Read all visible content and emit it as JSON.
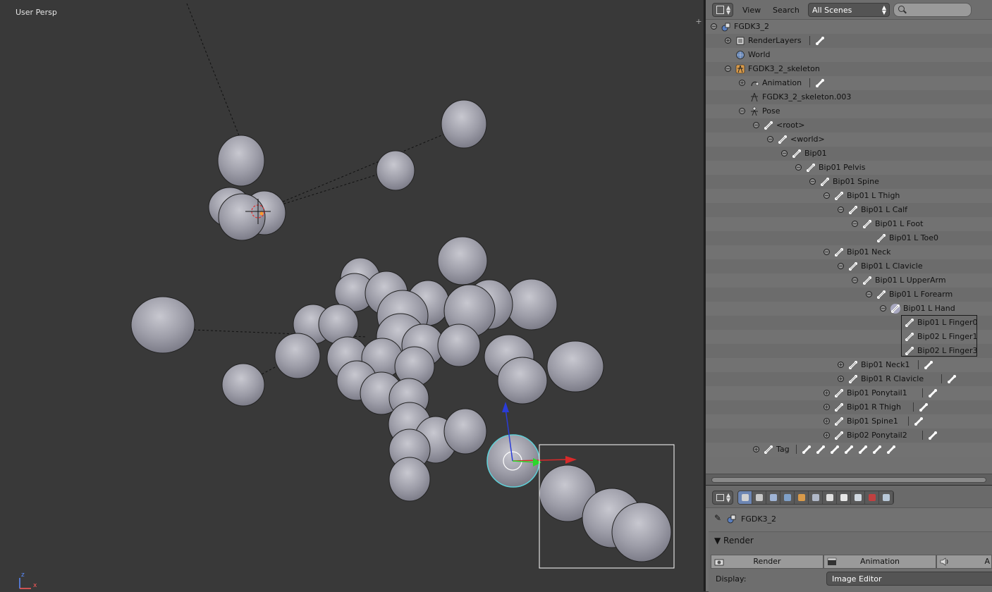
{
  "viewport": {
    "label": "User Persp",
    "axis_z": "z",
    "axis_x": "x",
    "plus_icon": "plus-icon"
  },
  "outliner": {
    "menu_view": "View",
    "menu_search": "Search",
    "scene_select": "All Scenes",
    "search_placeholder": "",
    "tree": [
      {
        "label": "FGDK3_2",
        "indent": 0,
        "exp": "minus",
        "icon": "scene-icon"
      },
      {
        "label": "RenderLayers",
        "indent": 1,
        "exp": "plus",
        "icon": "renderlayers-icon",
        "extra": 1
      },
      {
        "label": "World",
        "indent": 1,
        "exp": "none",
        "icon": "world-icon"
      },
      {
        "label": "FGDK3_2_skeleton",
        "indent": 1,
        "exp": "minus",
        "icon": "armature-object-icon"
      },
      {
        "label": "Animation",
        "indent": 2,
        "exp": "plus",
        "icon": "animation-icon",
        "extra": 1
      },
      {
        "label": "FGDK3_2_skeleton.003",
        "indent": 2,
        "exp": "none",
        "icon": "armature-data-icon"
      },
      {
        "label": "Pose",
        "indent": 2,
        "exp": "minus",
        "icon": "pose-icon"
      },
      {
        "label": "<root>",
        "indent": 3,
        "exp": "minus",
        "icon": "bone-icon"
      },
      {
        "label": "<world>",
        "indent": 4,
        "exp": "minus",
        "icon": "bone-icon"
      },
      {
        "label": "Bip01",
        "indent": 5,
        "exp": "minus",
        "icon": "bone-icon"
      },
      {
        "label": "Bip01 Pelvis",
        "indent": 6,
        "exp": "minus",
        "icon": "bone-icon"
      },
      {
        "label": "Bip01 Spine",
        "indent": 7,
        "exp": "minus",
        "icon": "bone-icon"
      },
      {
        "label": "Bip01 L Thigh",
        "indent": 8,
        "exp": "minus",
        "icon": "bone-icon"
      },
      {
        "label": "Bip01 L Calf",
        "indent": 9,
        "exp": "minus",
        "icon": "bone-icon"
      },
      {
        "label": "Bip01 L Foot",
        "indent": 10,
        "exp": "minus",
        "icon": "bone-icon"
      },
      {
        "label": "Bip01 L Toe0",
        "indent": 11,
        "exp": "none",
        "icon": "bone-icon"
      },
      {
        "label": "Bip01 Neck",
        "indent": 8,
        "exp": "minus",
        "icon": "bone-icon"
      },
      {
        "label": "Bip01 L Clavicle",
        "indent": 9,
        "exp": "minus",
        "icon": "bone-icon"
      },
      {
        "label": "Bip01 L UpperArm",
        "indent": 10,
        "exp": "minus",
        "icon": "bone-icon"
      },
      {
        "label": "Bip01 L Forearm",
        "indent": 11,
        "exp": "minus",
        "icon": "bone-icon"
      },
      {
        "label": "Bip01 L Hand",
        "indent": 12,
        "exp": "minus",
        "icon": "bone-icon",
        "active": true
      },
      {
        "label": "Bip01 L Finger0",
        "indent": 13,
        "exp": "none",
        "icon": "bone-icon"
      },
      {
        "label": "Bip02 L Finger1",
        "indent": 13,
        "exp": "none",
        "icon": "bone-icon"
      },
      {
        "label": "Bip02 L Finger3",
        "indent": 13,
        "exp": "none",
        "icon": "bone-icon"
      },
      {
        "label": "Bip01 Neck1",
        "indent": 9,
        "exp": "plus",
        "icon": "bone-icon",
        "extra": 1
      },
      {
        "label": "Bip01 R Clavicle",
        "indent": 9,
        "exp": "plus",
        "icon": "bone-icon",
        "extra": 1
      },
      {
        "label": "Bip01 Ponytail1",
        "indent": 8,
        "exp": "plus",
        "icon": "bone-icon",
        "extra": 1
      },
      {
        "label": "Bip01 R Thigh",
        "indent": 8,
        "exp": "plus",
        "icon": "bone-icon",
        "extra": 1
      },
      {
        "label": "Bip01 Spine1",
        "indent": 8,
        "exp": "plus",
        "icon": "bone-icon",
        "extra": 1
      },
      {
        "label": "Bip02 Ponytail2",
        "indent": 8,
        "exp": "plus",
        "icon": "bone-icon",
        "extra": 1
      },
      {
        "label": "Tag",
        "indent": 3,
        "exp": "plus",
        "icon": "bone-icon",
        "extra": 7
      }
    ]
  },
  "properties": {
    "context_name": "FGDK3_2",
    "panel_title": "Render",
    "render_button": "Render",
    "animation_button": "Animation",
    "audio_button": "A",
    "display_label": "Display:",
    "display_value": "Image Editor",
    "tabs": [
      {
        "name": "render-tab-icon",
        "color": "#d0d0d0",
        "active": true
      },
      {
        "name": "renderlayers-tab-icon",
        "color": "#c8c8c8"
      },
      {
        "name": "scene-tab-icon",
        "color": "#9fb4d6"
      },
      {
        "name": "world-tab-icon",
        "color": "#7fa0c8"
      },
      {
        "name": "object-tab-icon",
        "color": "#d89a4a"
      },
      {
        "name": "constraints-tab-icon",
        "color": "#b0b8c8"
      },
      {
        "name": "armature-data-tab-icon",
        "color": "#e0e0e0"
      },
      {
        "name": "bone-tab-icon",
        "color": "#e8e8e8"
      },
      {
        "name": "bone-constraints-tab-icon",
        "color": "#d0d8e0"
      },
      {
        "name": "texture-tab-icon",
        "color": "#c04040"
      },
      {
        "name": "physics-tab-icon",
        "color": "#b8c8d8"
      }
    ]
  },
  "colors": {
    "viewport_bg": "#393939",
    "outliner_bg": "#717171",
    "accent_blue": "#6d86b3",
    "sphere_fill": "#a4a4ae"
  }
}
